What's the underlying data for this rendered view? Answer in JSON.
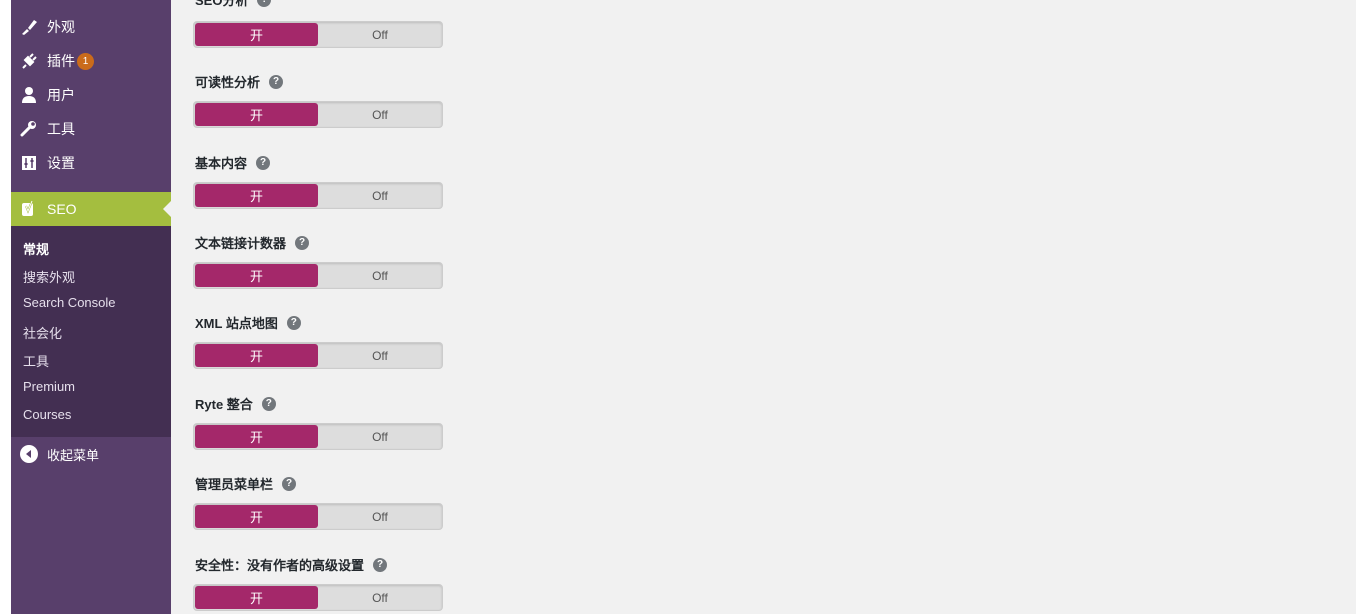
{
  "sidebar": {
    "menu": [
      {
        "label": "外观",
        "icon": "paintbrush-icon"
      },
      {
        "label": "插件",
        "icon": "plugin-icon",
        "badge": "1"
      },
      {
        "label": "用户",
        "icon": "user-icon"
      },
      {
        "label": "工具",
        "icon": "wrench-icon"
      },
      {
        "label": "设置",
        "icon": "settings-icon"
      }
    ],
    "seo": {
      "label": "SEO",
      "icon": "yoast-icon"
    },
    "submenu": [
      {
        "label": "常规",
        "active": true
      },
      {
        "label": "搜索外观"
      },
      {
        "label": "Search Console"
      },
      {
        "label": "社会化"
      },
      {
        "label": "工具"
      },
      {
        "label": "Premium"
      },
      {
        "label": "Courses"
      }
    ],
    "collapse_label": "收起菜单"
  },
  "settings": [
    {
      "label": "SEO分析",
      "on": "开",
      "off": "Off"
    },
    {
      "label": "可读性分析",
      "on": "开",
      "off": "Off"
    },
    {
      "label": "基本内容",
      "on": "开",
      "off": "Off"
    },
    {
      "label": "文本链接计数器",
      "on": "开",
      "off": "Off"
    },
    {
      "label": "XML 站点地图",
      "on": "开",
      "off": "Off"
    },
    {
      "label": "Ryte 整合",
      "on": "开",
      "off": "Off"
    },
    {
      "label": "管理员菜单栏",
      "on": "开",
      "off": "Off"
    },
    {
      "label": "安全性：没有作者的高级设置",
      "on": "开",
      "off": "Off"
    }
  ],
  "help_glyph": "?",
  "colors": {
    "sidebar_bg": "#583f6b",
    "submenu_bg": "#432f52",
    "seo_active": "#a4be3f",
    "toggle_on": "#a4286a",
    "badge": "#ca6b1b"
  }
}
